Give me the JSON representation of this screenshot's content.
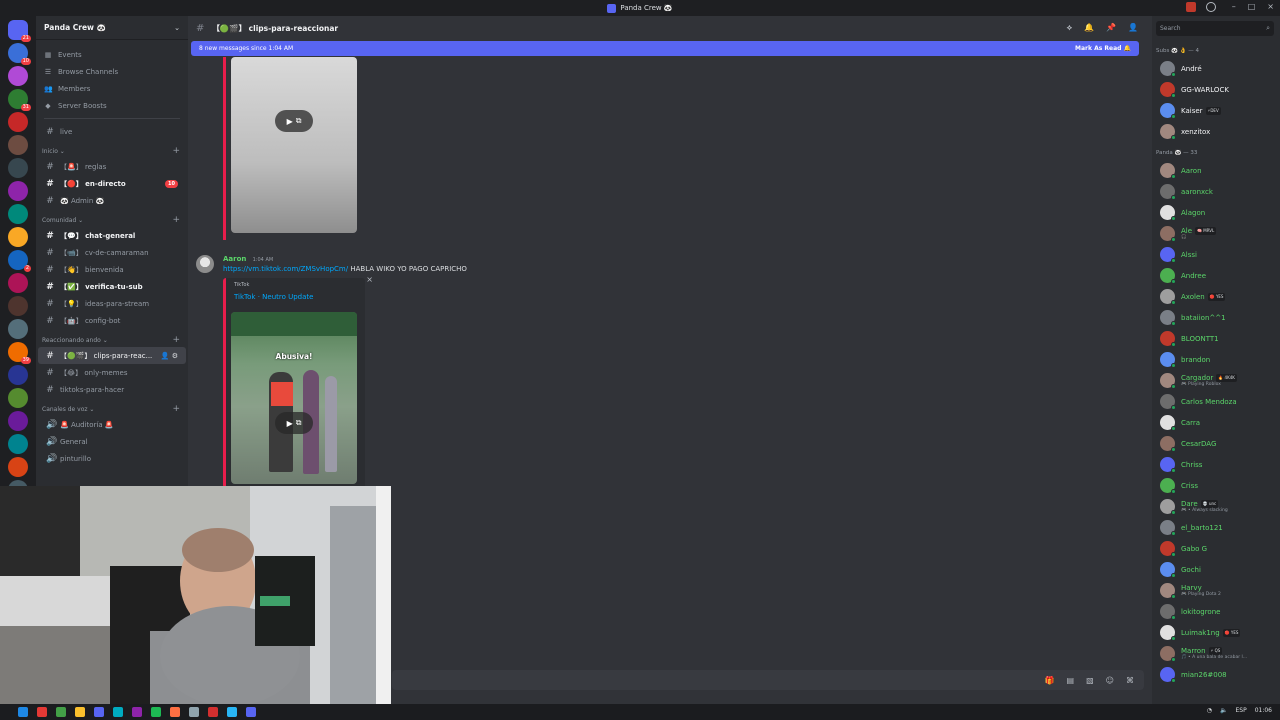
{
  "window": {
    "title": "Panda Crew 🐼",
    "minimize": "–",
    "maximize": "□",
    "close": "×"
  },
  "guild": {
    "name": "Panda Crew 🐼",
    "chevron": "⌄"
  },
  "sidebar": {
    "top_items": [
      {
        "label": "Events",
        "icon": "calendar-icon"
      },
      {
        "label": "Browse Channels",
        "icon": "browse-icon"
      },
      {
        "label": "Members",
        "icon": "members-icon"
      },
      {
        "label": "Server Boosts",
        "icon": "boost-icon"
      }
    ],
    "live_channel": "live",
    "categories": [
      {
        "name": "Inicio ⌄",
        "channels": [
          {
            "name": "【🚨】 reglas",
            "unread": false
          },
          {
            "name": "【🔴】 en-directo",
            "unread": true,
            "badge": "10"
          },
          {
            "name": "🐼 Admin 🐼",
            "unread": false
          }
        ]
      },
      {
        "name": "Comunidad ⌄",
        "channels": [
          {
            "name": "【💬】 chat-general",
            "unread": true
          },
          {
            "name": "【📹】 cv-de-camaraman",
            "unread": false
          },
          {
            "name": "【👋】 bienvenida",
            "unread": false
          },
          {
            "name": "【✅】 verifica-tu-sub",
            "unread": true
          },
          {
            "name": "【💡】 ideas-para-stream",
            "unread": false
          },
          {
            "name": "【🤖】 config-bot",
            "unread": false
          }
        ]
      },
      {
        "name": "Reaccionando ando ⌄",
        "channels": [
          {
            "name": "【🟢🎬】 clips-para-reac...",
            "active": true
          },
          {
            "name": "【😂】 only-memes",
            "unread": false
          },
          {
            "name": "tiktoks-para-hacer",
            "unread": false
          }
        ]
      },
      {
        "name": "Canales de voz ⌄",
        "channels": [
          {
            "name": "🚨 Auditoría 🚨",
            "unread": false
          },
          {
            "name": "General",
            "unread": false
          },
          {
            "name": "pinturillo",
            "unread": false
          }
        ]
      }
    ]
  },
  "rail": {
    "badges": [
      "21",
      "10",
      "",
      "31",
      "",
      "",
      "",
      "",
      "",
      "",
      "2",
      "",
      "",
      "",
      "39",
      "",
      "",
      "",
      "",
      "",
      "",
      "",
      "",
      "",
      "",
      "",
      "34",
      "",
      "46"
    ]
  },
  "chat": {
    "channel_name": "【🟢🎬】 clips-para-reaccionar",
    "new_messages_text": "8 new messages since 1:04 AM",
    "mark_as_read": "Mark As Read 🔔",
    "message": {
      "author": "Aaron",
      "time": "1:04 AM",
      "link": "https://vm.tiktok.com/ZMSvHopCm/",
      "text": "HABLA WIKO YO PAGO CAPRICHO"
    },
    "embed": {
      "provider": "TikTok",
      "title": "TikTok · Neutro Update",
      "caption": "Abusiva!",
      "close": "×"
    },
    "play_label": "▶"
  },
  "members": {
    "search_placeholder": "Search",
    "roles": [
      {
        "name": "Subs 🐼 👌 — 4",
        "members": [
          {
            "name": "André",
            "white": true,
            "tag": ""
          },
          {
            "name": "GG-WARLOCK",
            "white": true,
            "tag": ""
          },
          {
            "name": "Kaiser",
            "white": true,
            "tag": "⚡DEV"
          },
          {
            "name": "xenzitox",
            "white": true,
            "tag": ""
          }
        ]
      },
      {
        "name": "Panda 🐼 — 33",
        "members": [
          {
            "name": "Aaron",
            "tag": ""
          },
          {
            "name": "aaronxck",
            "tag": ""
          },
          {
            "name": "Alagon",
            "tag": ""
          },
          {
            "name": "Ale",
            "tag": "🧠 MRVL",
            "sub": "🎧"
          },
          {
            "name": "Alssi",
            "tag": ""
          },
          {
            "name": "Andree",
            "tag": ""
          },
          {
            "name": "Axolen",
            "tag": "🔴 YES"
          },
          {
            "name": "bataiion^^1",
            "tag": ""
          },
          {
            "name": "BLOONTT1",
            "tag": ""
          },
          {
            "name": "brandon",
            "tag": ""
          },
          {
            "name": "Cargador",
            "tag": "🔥 4K4K",
            "sub": "🎮 Playing Roblox"
          },
          {
            "name": "Carlos Mendoza",
            "tag": ""
          },
          {
            "name": "Carra",
            "tag": ""
          },
          {
            "name": "CesarDAG",
            "tag": ""
          },
          {
            "name": "Chriss",
            "tag": ""
          },
          {
            "name": "Criss",
            "tag": ""
          },
          {
            "name": "Dare",
            "tag": "💀 unc",
            "sub": "🎮 • Always slacking"
          },
          {
            "name": "el_barto121",
            "tag": ""
          },
          {
            "name": "Gabo G",
            "tag": ""
          },
          {
            "name": "Gochi",
            "tag": ""
          },
          {
            "name": "Harvy",
            "tag": "",
            "sub": "🎮 Playing Dota 2"
          },
          {
            "name": "lokitogrone",
            "tag": ""
          },
          {
            "name": "Luimak1ng",
            "tag": "🔴 YES"
          },
          {
            "name": "Marron",
            "tag": "⚡ QS",
            "sub": "🎵 • A una bala de acabar l..."
          },
          {
            "name": "mian26#008",
            "tag": ""
          }
        ]
      }
    ]
  },
  "taskbar": {
    "lang": "ESP",
    "time": "01:06"
  },
  "colors": {
    "accent": "#5865f2",
    "online": "#23a55a",
    "member_green": "#5bd66a",
    "mention_red": "#f23f43",
    "embed_border": "#e81e4c",
    "link": "#00a8fc"
  }
}
